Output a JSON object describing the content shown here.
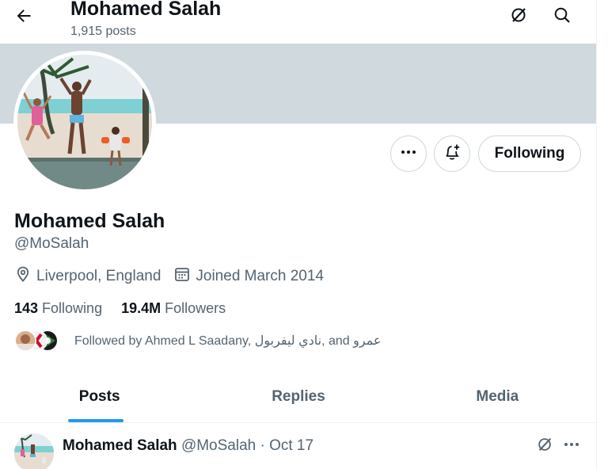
{
  "header": {
    "name": "Mohamed Salah",
    "posts_count": "1,915 posts",
    "back_icon": "arrow-left-icon",
    "grok_icon": "grok-icon",
    "search_icon": "search-icon"
  },
  "profile": {
    "name": "Mohamed Salah",
    "handle": "@MoSalah",
    "location": "Liverpool, England",
    "joined": "Joined March 2014",
    "following_count": "143",
    "following_label": "Following",
    "followers_count": "19.4M",
    "followers_label": "Followers",
    "followed_by": "Followed by Ahmed L Saadany, نادي ليفربول, and عمرو"
  },
  "actions": {
    "more_icon": "more-icon",
    "notify_icon": "bell-plus-icon",
    "follow_state": "Following"
  },
  "tabs": [
    {
      "label": "Posts",
      "active": true
    },
    {
      "label": "Replies",
      "active": false
    },
    {
      "label": "Media",
      "active": false
    }
  ],
  "tweet": {
    "name": "Mohamed Salah",
    "handle_time": "@MoSalah · Oct 17"
  },
  "colors": {
    "accent": "#1d9bf0",
    "banner": "#cfd9de",
    "secondary_text": "#536471"
  }
}
